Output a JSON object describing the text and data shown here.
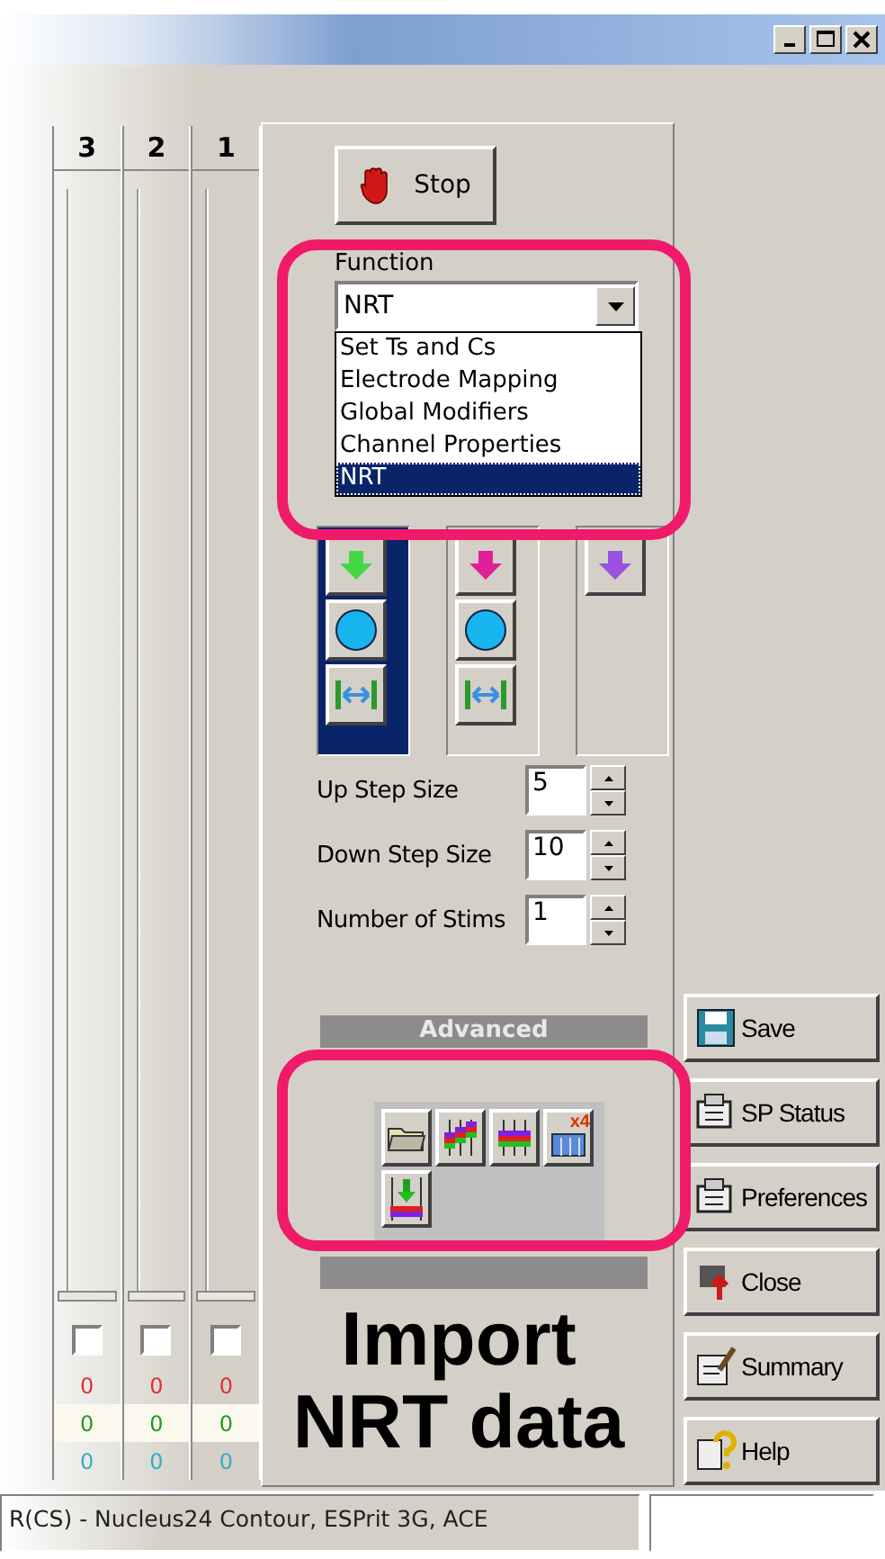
{
  "channels": [
    {
      "label": "3",
      "checked": false,
      "level": 0,
      "values": [
        "0",
        "0",
        "0"
      ]
    },
    {
      "label": "2",
      "checked": false,
      "level": 0,
      "values": [
        "0",
        "0",
        "0"
      ]
    },
    {
      "label": "1",
      "checked": false,
      "level": 0,
      "values": [
        "0",
        "0",
        "0"
      ]
    }
  ],
  "stop_button": {
    "label": "Stop"
  },
  "function": {
    "label": "Function",
    "value": "NRT",
    "expanded": true,
    "options": [
      {
        "label": "Set Ts and Cs",
        "selected": false
      },
      {
        "label": "Electrode Mapping",
        "selected": false
      },
      {
        "label": "Global Modifiers",
        "selected": false
      },
      {
        "label": "Channel Properties",
        "selected": false
      },
      {
        "label": "NRT",
        "selected": true
      }
    ]
  },
  "level_columns": [
    {
      "selected": true,
      "color": "#44d844",
      "buttons": [
        {
          "kind": "down"
        },
        {
          "kind": "circle"
        },
        {
          "kind": "spread"
        }
      ]
    },
    {
      "selected": false,
      "color": "#e0209a",
      "buttons": [
        {
          "kind": "down"
        },
        {
          "kind": "circle"
        },
        {
          "kind": "spread"
        }
      ]
    },
    {
      "selected": false,
      "color": "#9a50e0",
      "buttons": [
        {
          "kind": "down"
        }
      ]
    }
  ],
  "spin_fields": [
    {
      "label": "Up Step Size",
      "value": "5"
    },
    {
      "label": "Down Step Size",
      "value": "10"
    },
    {
      "label": "Number of Stims",
      "value": "1"
    }
  ],
  "advanced": {
    "label": "Advanced"
  },
  "import_toolbar": {
    "tools": [
      {
        "kind": "folder"
      },
      {
        "kind": "stepped"
      },
      {
        "kind": "level"
      },
      {
        "kind": "multiply",
        "badge": "x4"
      },
      {
        "kind": "import"
      }
    ]
  },
  "side_buttons": [
    {
      "label": "Save",
      "kind": "save"
    },
    {
      "label": "SP Status",
      "kind": "status"
    },
    {
      "label": "Preferences",
      "kind": "prefs"
    },
    {
      "label": "Close",
      "kind": "close"
    },
    {
      "label": "Summary",
      "kind": "summary"
    },
    {
      "label": "Help",
      "kind": "help"
    }
  ],
  "caption": {
    "lines": [
      "Import",
      "NRT data"
    ]
  },
  "status_bar": {
    "text": "R(CS) - Nucleus24 Contour, ESPrit 3G, ACE"
  }
}
